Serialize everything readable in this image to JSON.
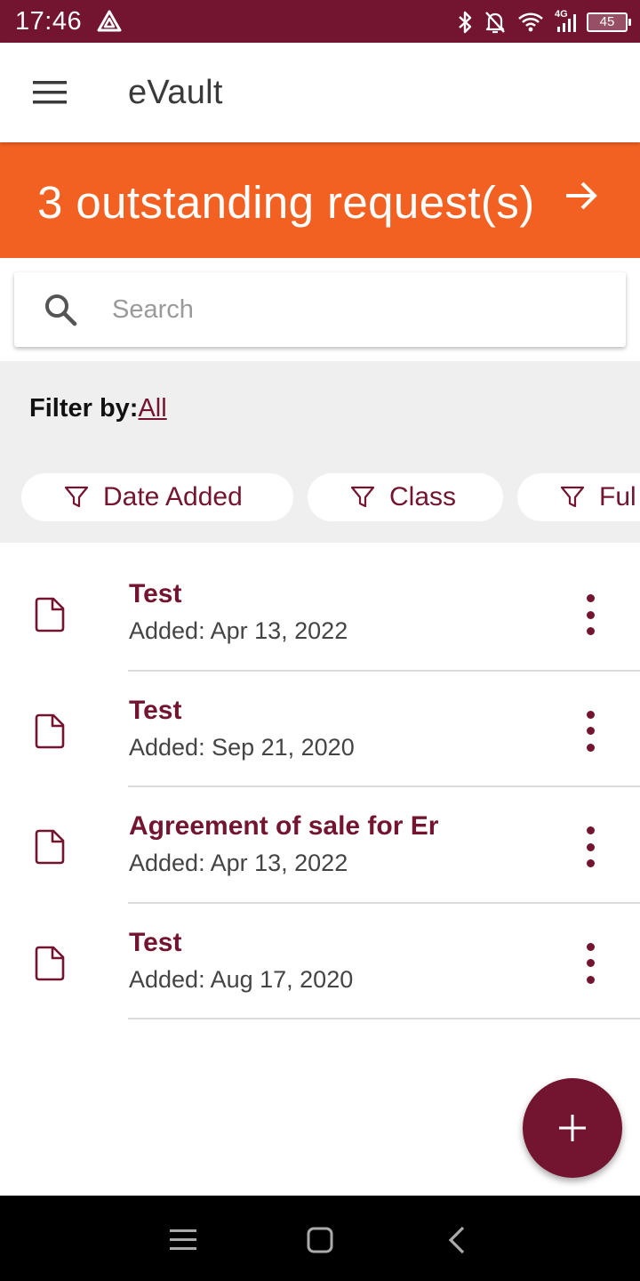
{
  "status_bar": {
    "time": "17:46",
    "battery_level": "45",
    "icons": [
      "app-triangle-icon",
      "bluetooth-icon",
      "mute-icon",
      "wifi-icon",
      "signal-4g-icon",
      "battery-icon"
    ],
    "network_type": "4G"
  },
  "app_bar": {
    "title": "eVault",
    "menu_icon": "menu-icon"
  },
  "banner": {
    "text": "3 outstanding request(s)",
    "icon": "arrow-right-icon",
    "color": "#f26122"
  },
  "search": {
    "placeholder": "Search",
    "value": ""
  },
  "filter": {
    "label": "Filter by:",
    "value": "All",
    "chips": [
      {
        "label": "Date Added",
        "icon": "filter-icon"
      },
      {
        "label": "Class",
        "icon": "filter-icon"
      },
      {
        "label": "Ful",
        "icon": "filter-icon"
      }
    ]
  },
  "documents": [
    {
      "title": "Test",
      "date": "Added: Apr 13, 2022"
    },
    {
      "title": "Test",
      "date": "Added: Sep 21, 2020"
    },
    {
      "title": "Agreement of sale for Er",
      "date": "Added: Apr 13, 2022"
    },
    {
      "title": "Test",
      "date": "Added: Aug 17, 2020"
    }
  ],
  "fab": {
    "icon": "plus-icon"
  },
  "nav_bar": {
    "buttons": [
      "recents-icon",
      "home-icon",
      "back-icon"
    ]
  },
  "colors": {
    "primary": "#731530",
    "accent": "#f26122",
    "filter_background": "#efefef"
  }
}
